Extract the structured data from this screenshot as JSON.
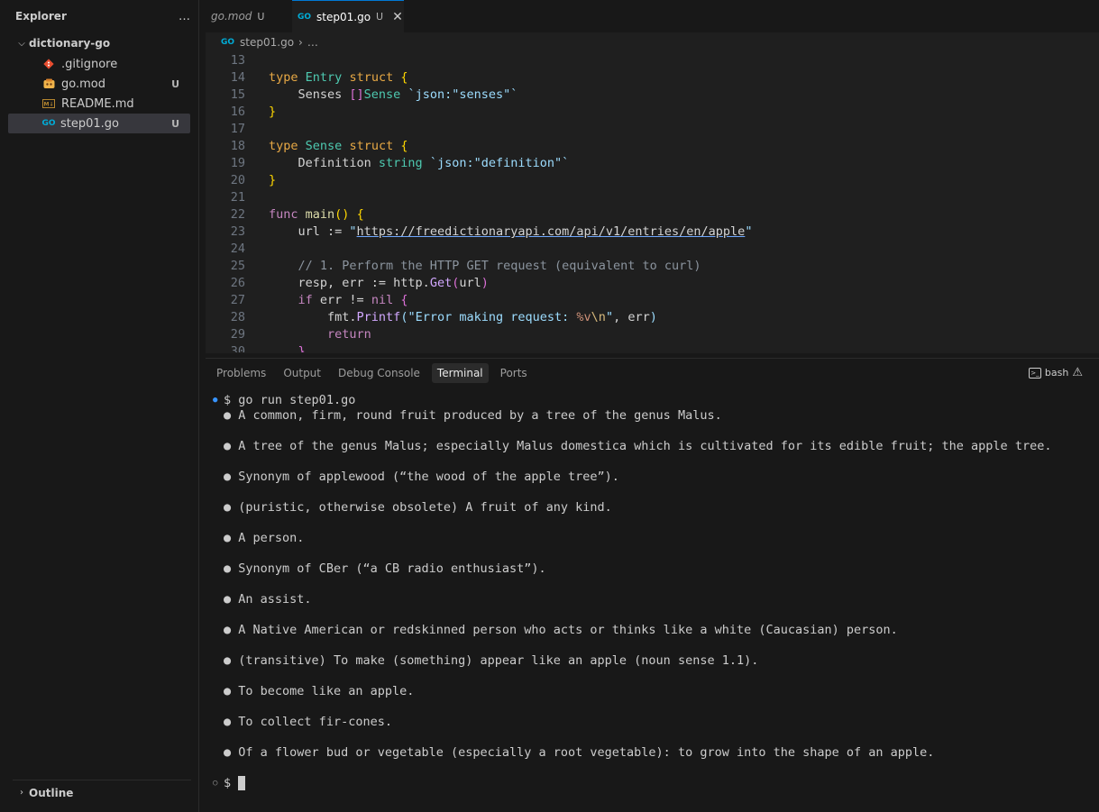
{
  "sidebar": {
    "title": "Explorer",
    "more_icon": "…",
    "folder": "dictionary-go",
    "files": [
      {
        "name": ".gitignore",
        "badge": "",
        "icon": "git-icon"
      },
      {
        "name": "go.mod",
        "badge": "U",
        "icon": "gomod-icon"
      },
      {
        "name": "README.md",
        "badge": "",
        "icon": "markdown-icon"
      },
      {
        "name": "step01.go",
        "badge": "U",
        "icon": "go-file-icon"
      }
    ],
    "outline": "Outline"
  },
  "tabs": [
    {
      "label": "go.mod",
      "badge": "U"
    },
    {
      "label": "step01.go",
      "badge": "U",
      "close": "✕"
    }
  ],
  "breadcrumb": {
    "file": "step01.go",
    "rest": "…"
  },
  "code": {
    "line_numbers": [
      "13",
      "14",
      "15",
      "16",
      "17",
      "18",
      "19",
      "20",
      "21",
      "22",
      "23",
      "24",
      "25",
      "26",
      "27",
      "28",
      "29",
      "30"
    ]
  },
  "panel": {
    "tabs": [
      "Problems",
      "Output",
      "Debug Console",
      "Terminal",
      "Ports"
    ],
    "active_tab": "Terminal",
    "shell": "bash",
    "prompt": "$",
    "command": "go run step01.go",
    "definitions": [
      "A common, firm, round fruit produced by a tree of the genus Malus.",
      "A tree of the genus Malus; especially Malus domestica which is cultivated for its edible fruit; the apple tree.",
      "Synonym of applewood (“the wood of the apple tree”).",
      "(puristic, otherwise obsolete) A fruit of any kind.",
      "A person.",
      "Synonym of CBer (“a CB radio enthusiast”).",
      "An assist.",
      "A Native American or redskinned person who acts or thinks like a white (Caucasian) person.",
      "(transitive) To make (something) appear like an apple (noun sense 1.1).",
      "To become like an apple.",
      "To collect fir-cones.",
      "Of a flower bud or vegetable (especially a root vegetable): to grow into the shape of an apple."
    ],
    "bullet": "●"
  }
}
